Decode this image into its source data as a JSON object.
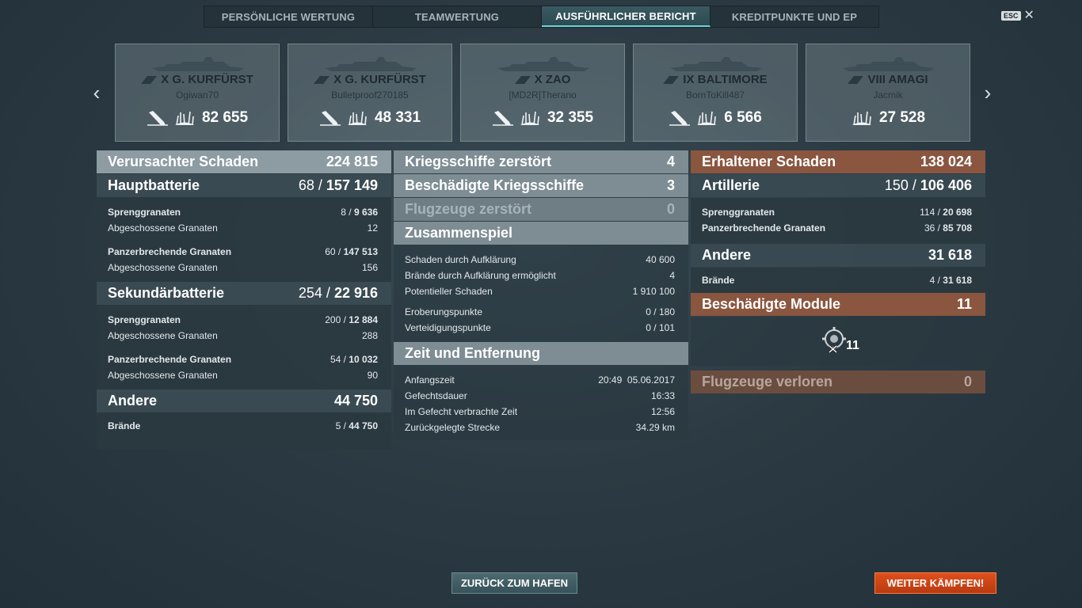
{
  "tabs": [
    {
      "label": "PERSÖNLICHE WERTUNG",
      "active": false
    },
    {
      "label": "TEAMWERTUNG",
      "active": false
    },
    {
      "label": "AUSFÜHRLICHER BERICHT",
      "active": true
    },
    {
      "label": "KREDITPUNKTE UND EP",
      "active": false
    }
  ],
  "esc": {
    "key": "ESC",
    "close": "✕"
  },
  "nav": {
    "prev": "‹",
    "next": "›"
  },
  "ships": [
    {
      "tier_name": "X G. KURFÜRST",
      "player": "Ogiwan70",
      "damage": "82 655",
      "sunk": true
    },
    {
      "tier_name": "X G. KURFÜRST",
      "player": "Bulletproof270185",
      "damage": "48 331",
      "sunk": true
    },
    {
      "tier_name": "X ZAO",
      "player": "[MD2R]Therano",
      "damage": "32 355",
      "sunk": true
    },
    {
      "tier_name": "IX BALTIMORE",
      "player": "BornToKill487",
      "damage": "6 566",
      "sunk": true
    },
    {
      "tier_name": "VIII AMAGI",
      "player": "Jacmik",
      "damage": "27 528",
      "sunk": false
    }
  ],
  "left": {
    "header": {
      "label": "Verursachter Schaden",
      "value": "224 815"
    },
    "main": {
      "label": "Hauptbatterie",
      "v1": "68 /",
      "v2": "157 149"
    },
    "main_he": {
      "label": "Sprenggranaten",
      "v1": "8 /",
      "v2": "9 636"
    },
    "main_he_fired": {
      "label": "Abgeschossene Granaten",
      "value": "12"
    },
    "main_ap": {
      "label": "Panzerbrechende Granaten",
      "v1": "60 /",
      "v2": "147 513"
    },
    "main_ap_fired": {
      "label": "Abgeschossene Granaten",
      "value": "156"
    },
    "secondary": {
      "label": "Sekundärbatterie",
      "v1": "254 /",
      "v2": "22 916"
    },
    "sec_he": {
      "label": "Sprenggranaten",
      "v1": "200 /",
      "v2": "12 884"
    },
    "sec_he_fired": {
      "label": "Abgeschossene Granaten",
      "value": "288"
    },
    "sec_ap": {
      "label": "Panzerbrechende Granaten",
      "v1": "54 /",
      "v2": "10 032"
    },
    "sec_ap_fired": {
      "label": "Abgeschossene Granaten",
      "value": "90"
    },
    "other": {
      "label": "Andere",
      "value": "44 750"
    },
    "fires": {
      "label": "Brände",
      "v1": "5 /",
      "v2": "44 750"
    }
  },
  "mid": {
    "destroyed": {
      "label": "Kriegsschiffe zerstört",
      "value": "4"
    },
    "damaged": {
      "label": "Beschädigte Kriegsschiffe",
      "value": "3"
    },
    "planes": {
      "label": "Flugzeuge zerstört",
      "value": "0"
    },
    "team": {
      "label": "Zusammenspiel"
    },
    "spot_dmg": {
      "label": "Schaden durch Aufklärung",
      "value": "40 600"
    },
    "spot_fires": {
      "label": "Brände durch Aufklärung ermöglicht",
      "value": "4"
    },
    "potential": {
      "label": "Potentieller Schaden",
      "value": "1 910 100"
    },
    "capture": {
      "label": "Eroberungspunkte",
      "value": "0 / 180"
    },
    "defense": {
      "label": "Verteidigungspunkte",
      "value": "0 / 101"
    },
    "time": {
      "label": "Zeit und Entfernung"
    },
    "start": {
      "label": "Anfangszeit",
      "value": "20:49  05.06.2017"
    },
    "duration": {
      "label": "Gefechtsdauer",
      "value": "16:33"
    },
    "in_battle": {
      "label": "Im Gefecht verbrachte Zeit",
      "value": "12:56"
    },
    "distance": {
      "label": "Zurückgelegte Strecke",
      "value": "34.29 km"
    }
  },
  "right": {
    "received": {
      "label": "Erhaltener Schaden",
      "value": "138 024"
    },
    "artillery": {
      "label": "Artillerie",
      "v1": "150 /",
      "v2": "106 406"
    },
    "art_he": {
      "label": "Sprenggranaten",
      "v1": "114 /",
      "v2": "20 698"
    },
    "art_ap": {
      "label": "Panzerbrechende Granaten",
      "v1": "36 /",
      "v2": "85 708"
    },
    "other": {
      "label": "Andere",
      "value": "31 618"
    },
    "fires": {
      "label": "Brände",
      "v1": "4 /",
      "v2": "31 618"
    },
    "modules": {
      "label": "Beschädigte Module",
      "value": "11",
      "count": "11"
    },
    "planes_lost": {
      "label": "Flugzeuge verloren",
      "value": "0"
    }
  },
  "buttons": {
    "back": "ZURÜCK ZUM HAFEN",
    "fight": "WEITER KÄMPFEN!"
  }
}
